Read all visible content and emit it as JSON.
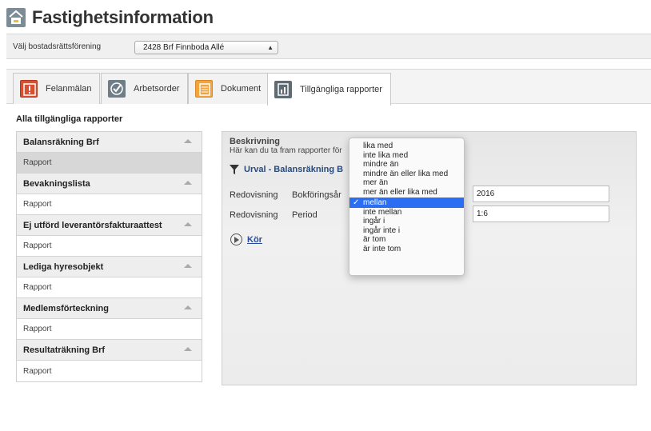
{
  "app": {
    "title": "Fastighetsinformation"
  },
  "association": {
    "label": "Välj bostadsrättsförening",
    "selected": "2428 Brf Finnboda Allé"
  },
  "tabs": [
    {
      "label": "Felanmälan",
      "icon": "warning-icon"
    },
    {
      "label": "Arbetsorder",
      "icon": "checkmark-icon"
    },
    {
      "label": "Dokument",
      "icon": "document-icon"
    },
    {
      "label": "Tillgängliga rapporter",
      "icon": "chart-icon",
      "active": true
    }
  ],
  "sidebar": {
    "title": "Alla tillgängliga rapporter",
    "groups": [
      {
        "name": "Balansräkning Brf",
        "item": "Rapport",
        "selected": true
      },
      {
        "name": "Bevakningslista",
        "item": "Rapport"
      },
      {
        "name": "Ej utförd leverantörsfakturaattest",
        "item": "Rapport"
      },
      {
        "name": "Lediga hyresobjekt",
        "item": "Rapport"
      },
      {
        "name": "Medlemsförteckning",
        "item": "Rapport"
      },
      {
        "name": "Resultaträkning Brf",
        "item": "Rapport"
      }
    ]
  },
  "panel": {
    "desc_title": "Beskrivning",
    "desc_text": "Här kan du ta fram rapporter för",
    "filter_title": "Urval - Balansräkning B",
    "criteria": [
      {
        "label": "Redovisning",
        "field": "Bokföringsår",
        "value": "2016"
      },
      {
        "label": "Redovisning",
        "field": "Period",
        "value": "1:6"
      }
    ],
    "run_label": "Kör"
  },
  "dropdown": {
    "options": [
      "lika med",
      "inte lika med",
      "mindre än",
      "mindre än eller lika med",
      "mer än",
      "mer än eller lika med",
      "mellan",
      "inte mellan",
      "ingår i",
      "ingår inte i",
      "är tom",
      "är inte tom"
    ],
    "selected": "mellan",
    "check_glyph": "✓"
  }
}
